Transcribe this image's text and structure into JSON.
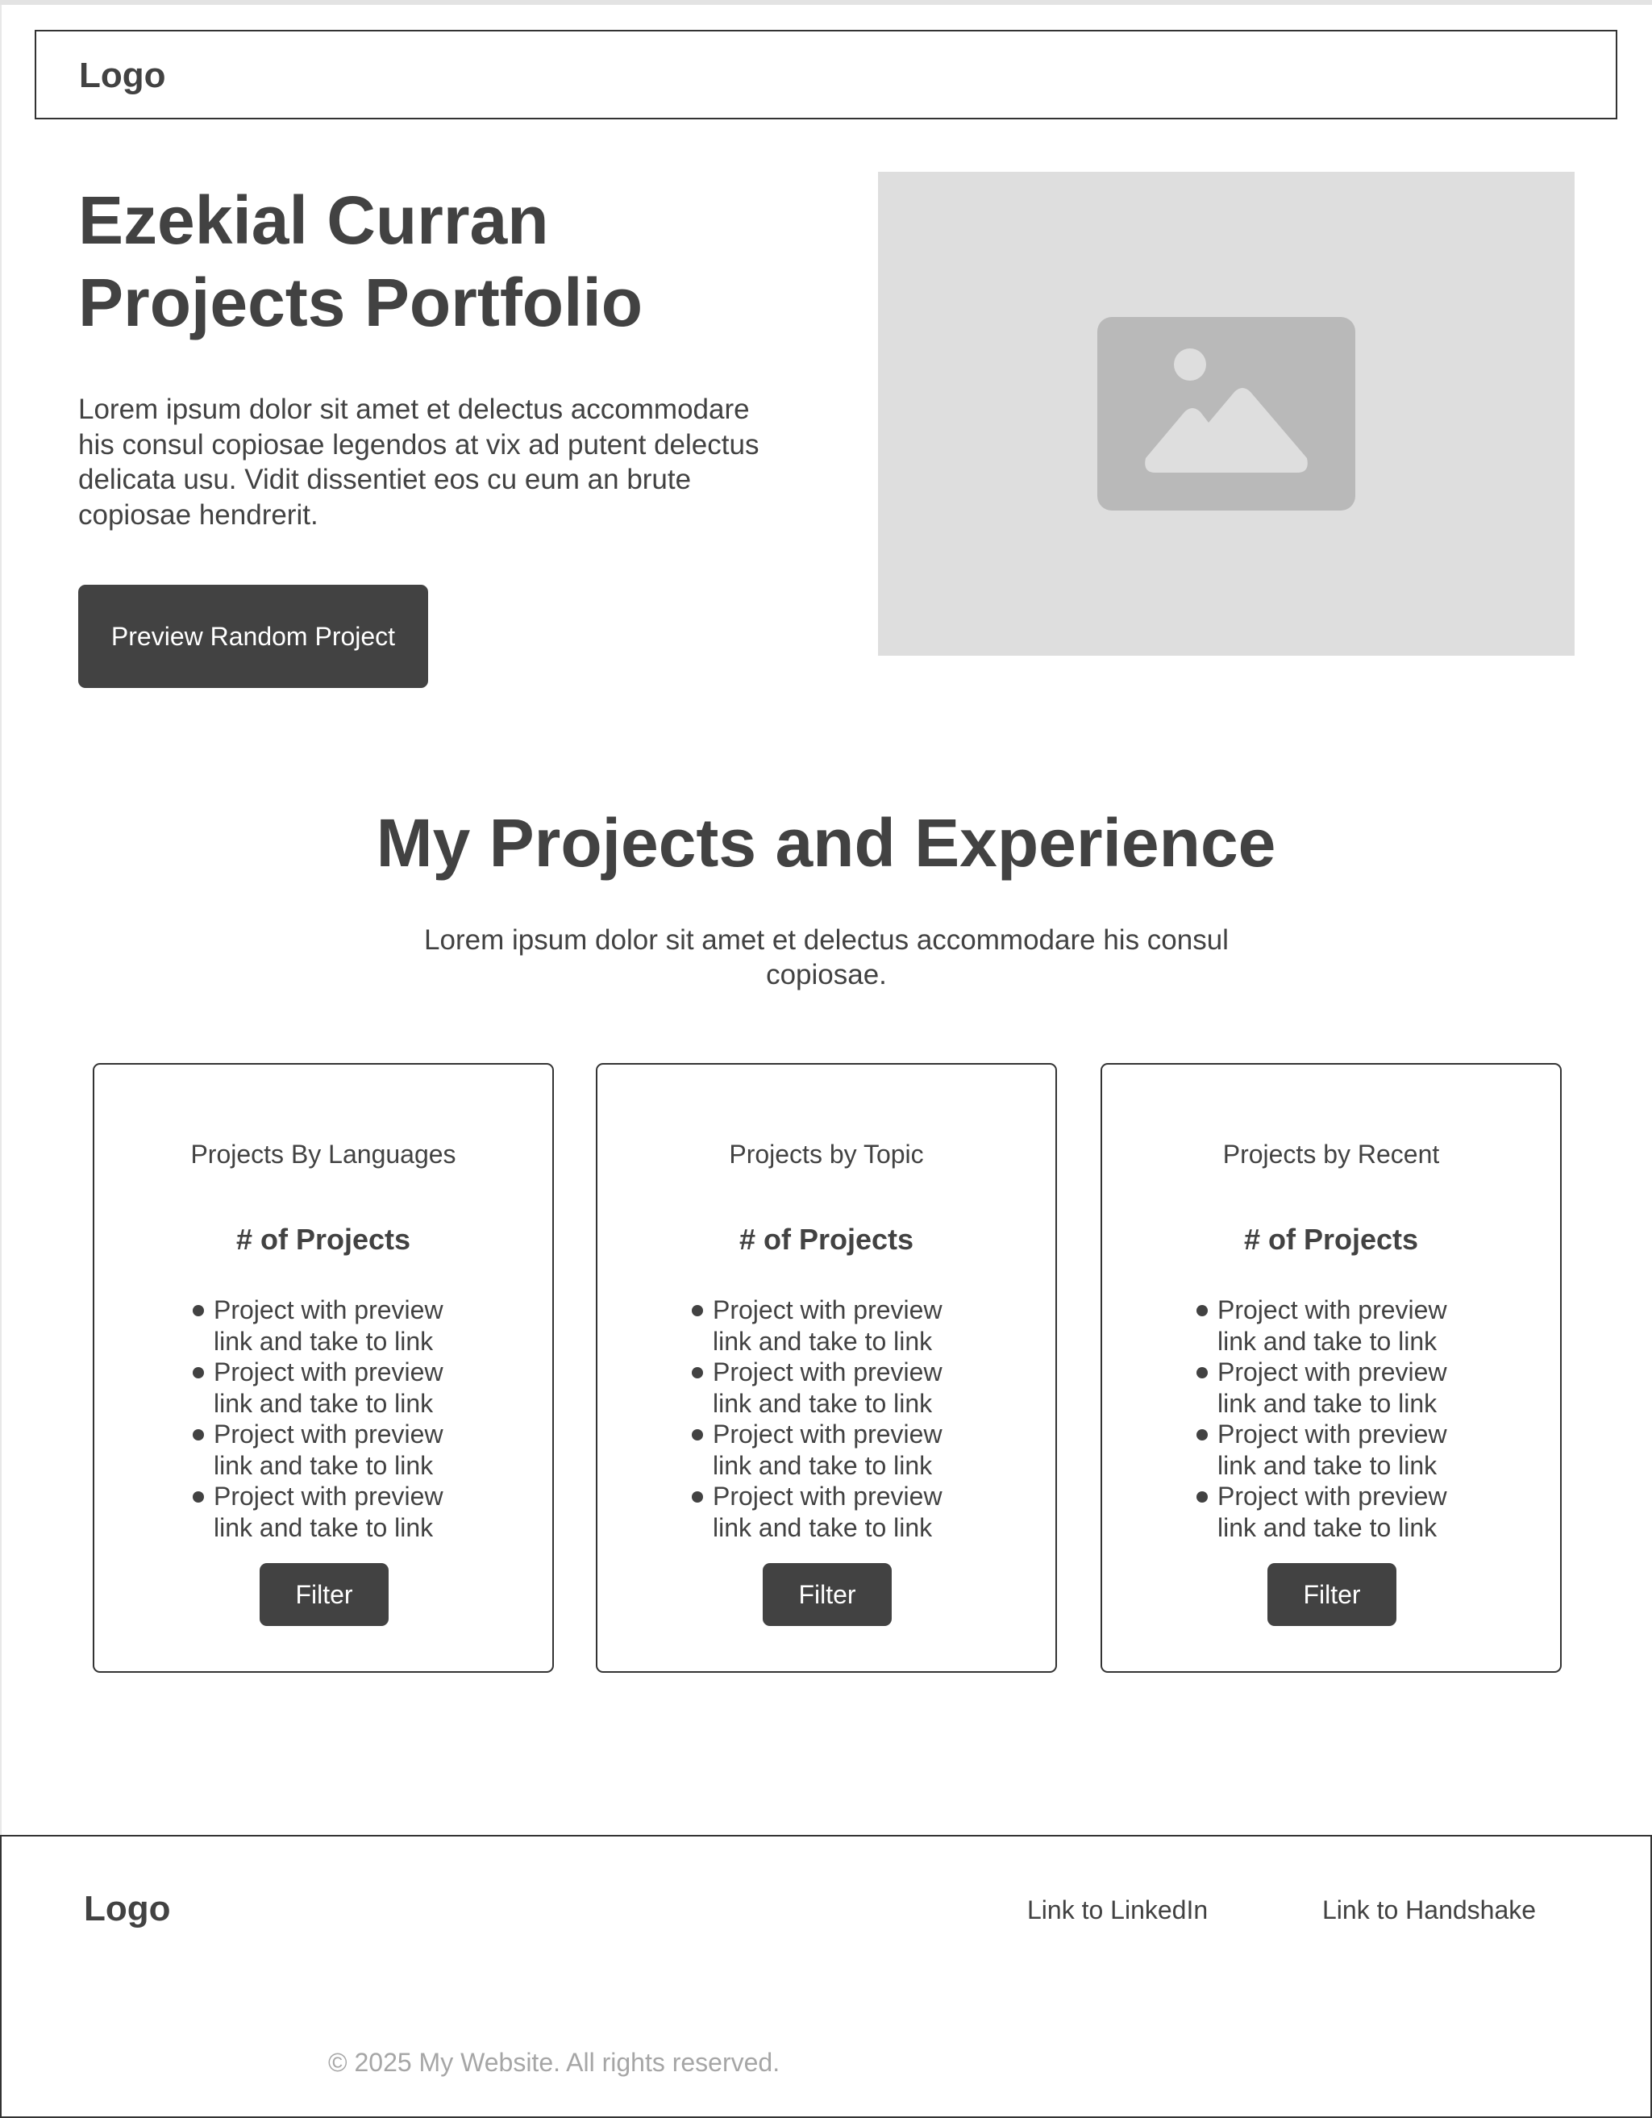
{
  "header": {
    "logo": "Logo"
  },
  "hero": {
    "title_line1": "Ezekial Curran",
    "title_line2": "Projects Portfolio",
    "description": "Lorem ipsum dolor sit amet et delectus accommodare his consul copiosae legendos at vix ad putent delectus delicata usu. Vidit dissentiet eos cu eum an brute copiosae hendrerit.",
    "button_label": "Preview Random Project",
    "image_icon": "image-placeholder-icon",
    "image_bg_color": "#dedede",
    "image_icon_color": "#b9b9b9"
  },
  "projects_section": {
    "title": "My Projects and Experience",
    "subtitle": "Lorem ipsum dolor sit amet et delectus accommodare his consul copiosae.",
    "cards": [
      {
        "title": "Projects By Languages",
        "count_label": "# of Projects",
        "items": [
          "Project with preview link and take to link",
          "Project with preview link and take to link",
          "Project with preview link and take to link",
          "Project with preview link and take to link"
        ],
        "button_label": "Filter"
      },
      {
        "title": "Projects by Topic",
        "count_label": "# of Projects",
        "items": [
          "Project with preview link and take to link",
          "Project with preview link and take to link",
          "Project with preview link and take to link",
          "Project with preview link and take to link"
        ],
        "button_label": "Filter"
      },
      {
        "title": "Projects by Recent",
        "count_label": "# of Projects",
        "items": [
          "Project with preview link and take to link",
          "Project with preview link and take to link",
          "Project with preview link and take to link",
          "Project with preview link and take to link"
        ],
        "button_label": "Filter"
      }
    ]
  },
  "footer": {
    "logo": "Logo",
    "links": [
      "Link to LinkedIn",
      "Link to Handshake"
    ],
    "copyright": "© 2025 My Website. All rights reserved."
  },
  "colors": {
    "text": "#424242",
    "button_bg": "#424242",
    "button_text": "#ffffff",
    "border": "#333333",
    "muted_text": "#a6a6a6"
  }
}
